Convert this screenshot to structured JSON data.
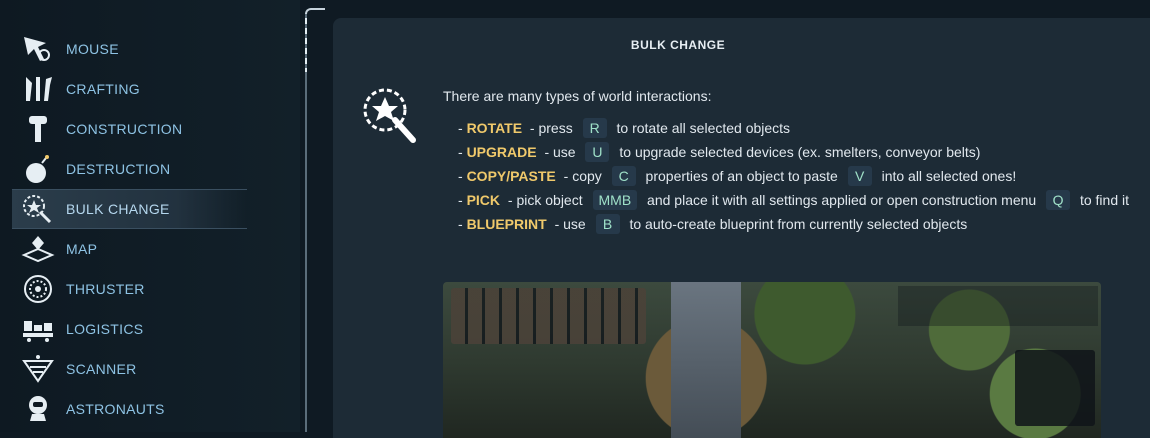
{
  "sidebar": {
    "items": [
      {
        "label": "MOUSE",
        "icon": "mouse-cursor-icon"
      },
      {
        "label": "CRAFTING",
        "icon": "crafting-tools-icon"
      },
      {
        "label": "CONSTRUCTION",
        "icon": "construction-bolt-icon"
      },
      {
        "label": "DESTRUCTION",
        "icon": "bomb-icon"
      },
      {
        "label": "BULK CHANGE",
        "icon": "magic-wand-icon",
        "active": true
      },
      {
        "label": "MAP",
        "icon": "map-pin-icon"
      },
      {
        "label": "THRUSTER",
        "icon": "thruster-icon"
      },
      {
        "label": "LOGISTICS",
        "icon": "logistics-icon"
      },
      {
        "label": "SCANNER",
        "icon": "scanner-icon"
      },
      {
        "label": "ASTRONAUTS",
        "icon": "astronaut-icon"
      }
    ]
  },
  "panel": {
    "title": "BULK CHANGE",
    "icon": "magic-wand-icon",
    "intro": "There are many types of world interactions:",
    "bullets": [
      {
        "keyword": "ROTATE",
        "parts": [
          " - press ",
          {
            "key": "R"
          },
          " to rotate all selected objects"
        ]
      },
      {
        "keyword": "UPGRADE",
        "parts": [
          " - use ",
          {
            "key": "U"
          },
          " to upgrade selected devices (ex. smelters, conveyor belts)"
        ]
      },
      {
        "keyword": "COPY/PASTE",
        "parts": [
          " - copy ",
          {
            "key": "C"
          },
          " properties of an object to paste ",
          {
            "key": "V"
          },
          " into all selected ones!"
        ]
      },
      {
        "keyword": "PICK",
        "parts": [
          " - pick object ",
          {
            "key": "MMB"
          },
          " and place it with all settings applied or open construction menu ",
          {
            "key": "Q"
          },
          " to find it"
        ]
      },
      {
        "keyword": "BLUEPRINT",
        "parts": [
          " - use ",
          {
            "key": "B"
          },
          " to auto-create blueprint from currently selected objects"
        ]
      }
    ]
  },
  "colors": {
    "accent": "#f0c96b",
    "key_text": "#9fe0c8",
    "nav_text": "#8ec3e4",
    "panel_bg": "#1d2b36"
  }
}
